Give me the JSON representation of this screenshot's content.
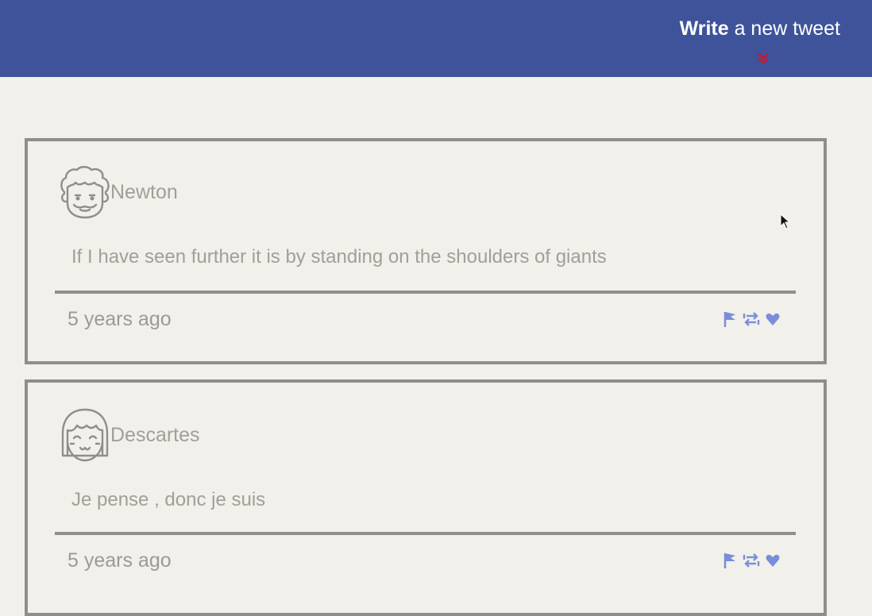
{
  "header": {
    "write_strong": "Write",
    "write_rest": " a new tweet",
    "expand_icon": "double-chevron-down-icon",
    "background_color": "#3e5399",
    "chevron_color": "#d4142a"
  },
  "tweets": [
    {
      "username": "Newton",
      "avatar_icon": "curly-hair-face-icon",
      "text": "If I have seen further it is by standing on the shoulders of giants",
      "time": "5 years ago",
      "actions": [
        "flag-icon",
        "retweet-icon",
        "heart-icon"
      ]
    },
    {
      "username": "Descartes",
      "avatar_icon": "bob-hair-face-icon",
      "text": "Je pense , donc je suis",
      "time": "5 years ago",
      "actions": [
        "flag-icon",
        "retweet-icon",
        "heart-icon"
      ]
    }
  ],
  "colors": {
    "page_background": "#f1f0ea",
    "card_border": "#8f8e89",
    "text_muted": "#a29e98",
    "action_icon": "#7a8ed8"
  }
}
